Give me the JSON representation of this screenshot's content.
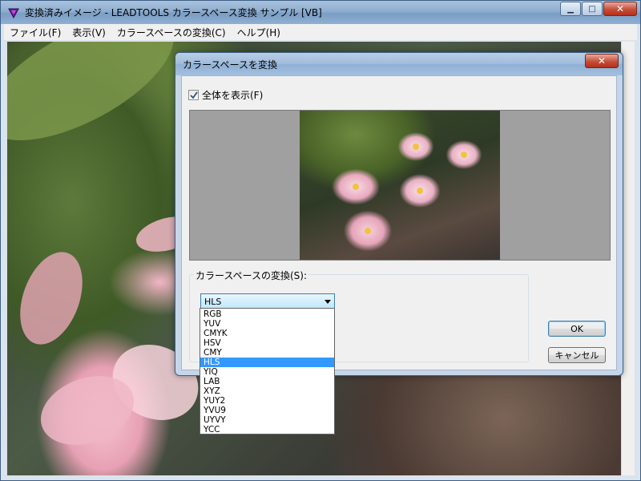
{
  "main_window": {
    "title": "変換済みイメージ - LEADTOOLS カラースペース変換 サンプル [VB]",
    "controls": {
      "minimize": "▁",
      "maximize": "□",
      "close": "✕"
    },
    "menu": [
      "ファイル(F)",
      "表示(V)",
      "カラースペースの変換(C)",
      "ヘルプ(H)"
    ]
  },
  "dialog": {
    "title": "カラースペースを変換",
    "close": "✕",
    "show_all_label": "全体を表示(F)",
    "show_all_checked": true,
    "group_label": "カラースペースの変換(S):",
    "selected_value": "HLS",
    "options": [
      "RGB",
      "YUV",
      "CMYK",
      "HSV",
      "CMY",
      "HLS",
      "YIQ",
      "LAB",
      "XYZ",
      "YUY2",
      "YVU9",
      "UYVY",
      "YCC"
    ],
    "ok_label": "OK",
    "cancel_label": "キャンセル"
  },
  "icons": {
    "app": "triangle-app-icon",
    "check": "checkmark-icon",
    "arrow": "dropdown-arrow-icon"
  },
  "colors": {
    "selection": "#3399ff",
    "title_bar": "#9fbbdb",
    "close_button": "#c44f3a"
  }
}
